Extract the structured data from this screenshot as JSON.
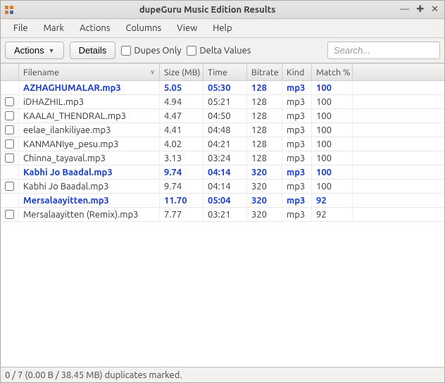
{
  "window": {
    "title": "dupeGuru Music Edition Results"
  },
  "menus": [
    "File",
    "Mark",
    "Actions",
    "Columns",
    "View",
    "Help"
  ],
  "toolbar": {
    "actions_label": "Actions",
    "details_label": "Details",
    "dupes_only_label": "Dupes Only",
    "delta_values_label": "Delta Values",
    "search_placeholder": "Search..."
  },
  "columns": {
    "filename": "Filename",
    "size": "Size (MB)",
    "time": "Time",
    "bitrate": "Bitrate",
    "kind": "Kind",
    "match": "Match %"
  },
  "rows": [
    {
      "master": true,
      "filename": "AZHAGHUMALAR.mp3",
      "size": "5.05",
      "time": "05:30",
      "bitrate": "128",
      "kind": "mp3",
      "match": "100"
    },
    {
      "master": false,
      "filename": "iDHAZHIL.mp3",
      "size": "4.94",
      "time": "05:21",
      "bitrate": "128",
      "kind": "mp3",
      "match": "100"
    },
    {
      "master": false,
      "filename": "KAALAI_THENDRAL.mp3",
      "size": "4.47",
      "time": "04:50",
      "bitrate": "128",
      "kind": "mp3",
      "match": "100"
    },
    {
      "master": false,
      "filename": "eelae_ilankiliyae.mp3",
      "size": "4.41",
      "time": "04:48",
      "bitrate": "128",
      "kind": "mp3",
      "match": "100"
    },
    {
      "master": false,
      "filename": "KANMANIye_pesu.mp3",
      "size": "4.02",
      "time": "04:21",
      "bitrate": "128",
      "kind": "mp3",
      "match": "100"
    },
    {
      "master": false,
      "filename": "Chinna_tayaval.mp3",
      "size": "3.13",
      "time": "03:24",
      "bitrate": "128",
      "kind": "mp3",
      "match": "100"
    },
    {
      "master": true,
      "filename": "Kabhi Jo Baadal.mp3",
      "size": "9.74",
      "time": "04:14",
      "bitrate": "320",
      "kind": "mp3",
      "match": "100"
    },
    {
      "master": false,
      "filename": "Kabhi Jo Baadal.mp3",
      "size": "9.74",
      "time": "04:14",
      "bitrate": "320",
      "kind": "mp3",
      "match": "100"
    },
    {
      "master": true,
      "filename": "Mersalaayitten.mp3",
      "size": "11.70",
      "time": "05:04",
      "bitrate": "320",
      "kind": "mp3",
      "match": "92"
    },
    {
      "master": false,
      "filename": "Mersalaayitten (Remix).mp3",
      "size": "7.77",
      "time": "03:21",
      "bitrate": "320",
      "kind": "mp3",
      "match": "92"
    }
  ],
  "statusbar": {
    "text": "0 / 7 (0.00 B / 38.45 MB) duplicates marked."
  }
}
